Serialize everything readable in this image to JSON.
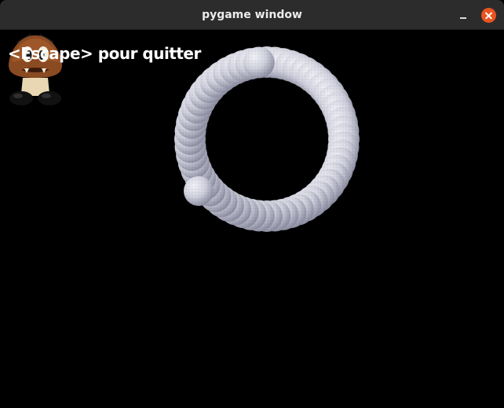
{
  "window": {
    "title": "pygame window",
    "minimize_icon": "minimize-icon",
    "close_icon": "close-icon",
    "close_color": "#e95420"
  },
  "game": {
    "background": "#000000",
    "instruction_text": "<Escape> pour quitter",
    "sprite": "goomba",
    "ball_color": "#c9cad8"
  }
}
